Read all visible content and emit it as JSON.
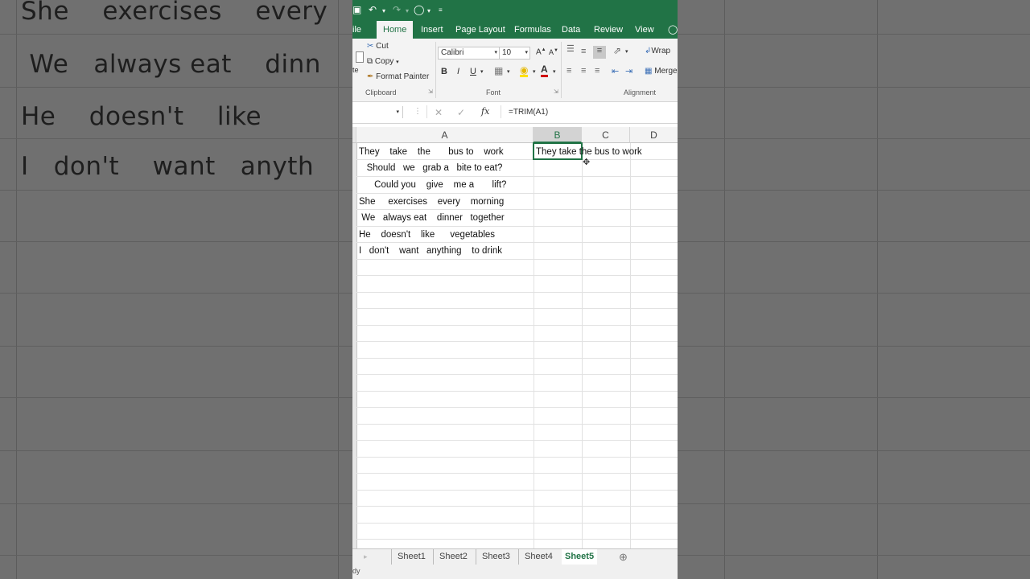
{
  "background_text": [
    "She    exercises    every",
    " We   always eat    dinn",
    "He    doesn't    like     ",
    "I   don't    want   anyth"
  ],
  "qat": {
    "save_icon": "save-icon",
    "undo_icon": "undo-icon",
    "redo_icon": "redo-icon",
    "circle_icon": "shape-icon"
  },
  "tabs": [
    "ile",
    "Home",
    "Insert",
    "Page Layout",
    "Formulas",
    "Data",
    "Review",
    "View"
  ],
  "clipboard": {
    "paste_label": "te",
    "cut": "Cut",
    "copy": "Copy",
    "format_painter": "Format Painter",
    "group": "Clipboard"
  },
  "font": {
    "name": "Calibri",
    "size": "10",
    "bold": "B",
    "italic": "I",
    "underline": "U",
    "group": "Font",
    "grow": "A",
    "shrink": "A",
    "color_glyph": "A"
  },
  "alignment": {
    "wrap": "Wrap",
    "merge": "Merge",
    "group": "Alignment"
  },
  "formula_bar": {
    "name_box": "",
    "formula": "=TRIM(A1)",
    "fx": "fx"
  },
  "columns": [
    "A",
    "B",
    "C",
    "D"
  ],
  "rows": [
    {
      "a": "They    take    the       bus to    work",
      "b": "They take the bus to work"
    },
    {
      "a": "   Should   we   grab a   bite to eat?",
      "b": ""
    },
    {
      "a": "      Could you    give    me a       lift?",
      "b": ""
    },
    {
      "a": "She     exercises    every    morning",
      "b": ""
    },
    {
      "a": " We   always eat    dinner   together",
      "b": ""
    },
    {
      "a": "He    doesn't    like      vegetables",
      "b": ""
    },
    {
      "a": "I   don't    want   anything    to drink",
      "b": ""
    }
  ],
  "sheets": [
    "Sheet1",
    "Sheet2",
    "Sheet3",
    "Sheet4",
    "Sheet5"
  ],
  "active_sheet": "Sheet5",
  "status": "dy",
  "colors": {
    "accent": "#217346"
  }
}
